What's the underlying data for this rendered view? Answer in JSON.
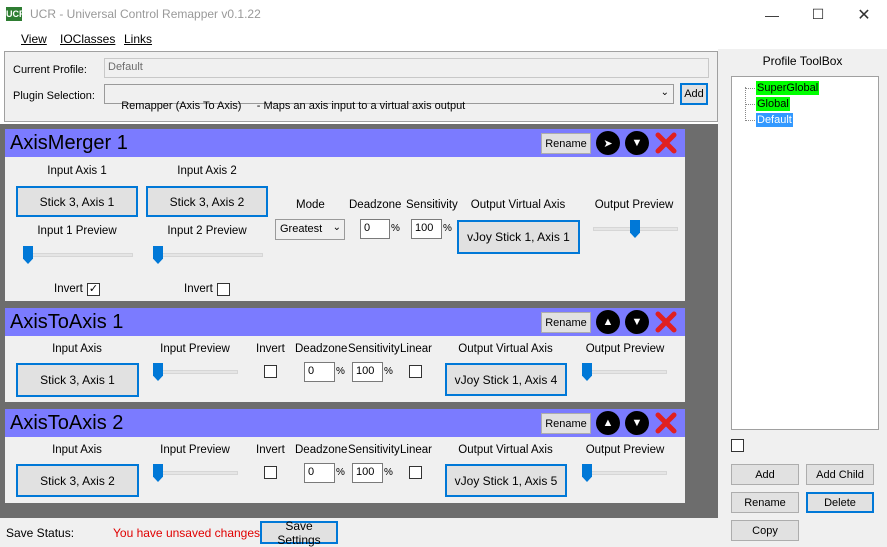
{
  "window": {
    "icon_text": "UCR",
    "title": "UCR - Universal Control Remapper v0.1.22"
  },
  "menu": [
    "View",
    "IOClasses",
    "Links"
  ],
  "profile": {
    "current_label": "Current Profile:",
    "current_value": "Default",
    "plugin_label": "Plugin Selection:",
    "plugin_value": "Remapper (Axis To Axis)     - Maps an axis input to a virtual axis output",
    "add_label": "Add"
  },
  "common": {
    "rename": "Rename",
    "up_icon": "chevron-up-icon",
    "down_icon": "chevron-down-icon",
    "remove_icon": "red-x-icon"
  },
  "plugins": [
    {
      "title": "AxisMerger 1",
      "input1_label": "Input Axis 1",
      "input1_value": "Stick 3, Axis 1",
      "input2_label": "Input Axis 2",
      "input2_value": "Stick 3, Axis 2",
      "preview1_label": "Input 1 Preview",
      "preview2_label": "Input 2 Preview",
      "mode_label": "Mode",
      "mode_value": "Greatest",
      "deadzone_label": "Deadzone",
      "deadzone_value": "0",
      "sensitivity_label": "Sensitivity",
      "sensitivity_value": "100",
      "pct": "%",
      "output_label": "Output Virtual Axis",
      "output_value": "vJoy Stick 1, Axis 1",
      "output_preview_label": "Output Preview",
      "invert_label": "Invert",
      "invert1_checked": true,
      "invert2_checked": false,
      "input1_level": 0,
      "input2_level": 0,
      "output_level": 0.5
    },
    {
      "title": "AxisToAxis 1",
      "input_label": "Input Axis",
      "input_value": "Stick 3, Axis 1",
      "preview_label": "Input Preview",
      "invert_label": "Invert",
      "deadzone_label": "Deadzone",
      "deadzone_value": "0",
      "sensitivity_label": "Sensitivity",
      "sensitivity_value": "100",
      "linear_label": "Linear",
      "pct": "%",
      "output_label": "Output Virtual Axis",
      "output_value": "vJoy Stick 1, Axis 4",
      "output_preview_label": "Output Preview",
      "input_level": 0,
      "output_level": 0
    },
    {
      "title": "AxisToAxis 2",
      "input_label": "Input Axis",
      "input_value": "Stick 3, Axis 2",
      "preview_label": "Input Preview",
      "invert_label": "Invert",
      "deadzone_label": "Deadzone",
      "deadzone_value": "0",
      "sensitivity_label": "Sensitivity",
      "sensitivity_value": "100",
      "linear_label": "Linear",
      "pct": "%",
      "output_label": "Output Virtual Axis",
      "output_value": "vJoy Stick 1, Axis 5",
      "output_preview_label": "Output Preview",
      "input_level": 0,
      "output_level": 0
    }
  ],
  "save": {
    "label": "Save Status:",
    "status": "You have unsaved changes",
    "status_color": "#e00000",
    "button": "Save Settings"
  },
  "toolbox": {
    "title": "Profile ToolBox",
    "tree": [
      {
        "label": "SuperGlobal",
        "color": "#00ff00"
      },
      {
        "label": "Global",
        "color": "#00ff00"
      },
      {
        "label": "Default",
        "color": "#3399ff"
      }
    ],
    "add": "Add",
    "add_child": "Add Child",
    "rename": "Rename",
    "delete": "Delete",
    "copy": "Copy"
  },
  "colors": {
    "header_bg": "#7b7bff",
    "accent": "#0078d7",
    "workspace": "#6d6d6d"
  }
}
